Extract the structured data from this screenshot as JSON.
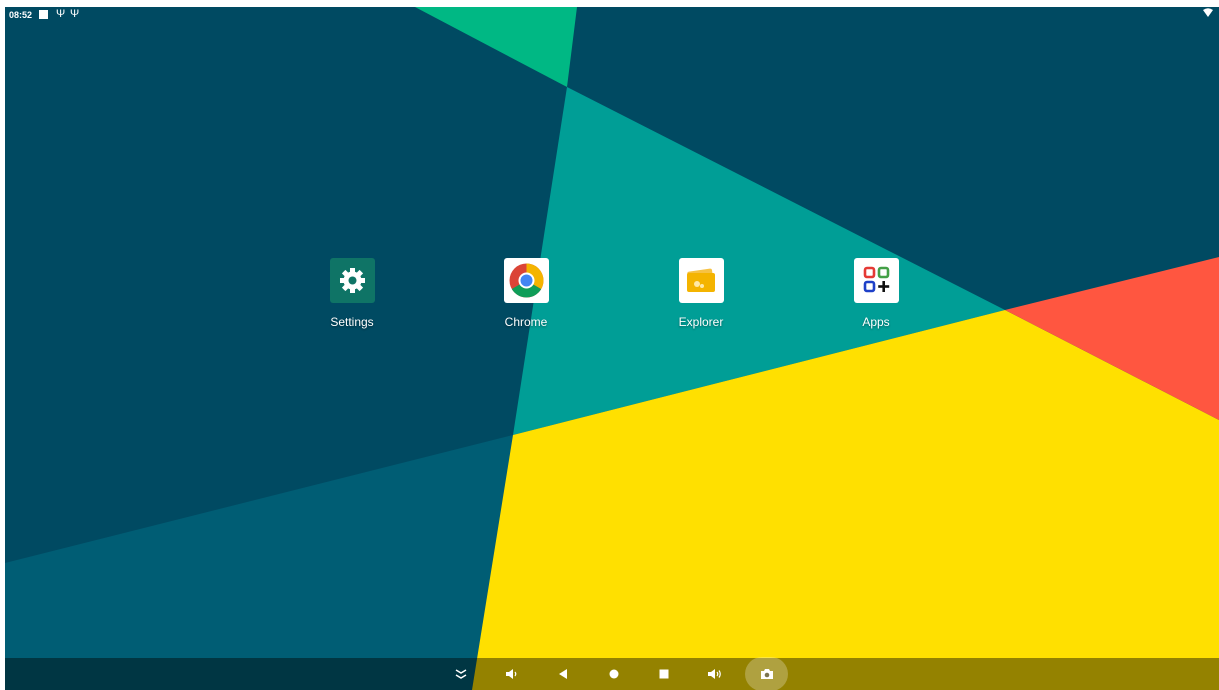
{
  "status_bar": {
    "time": "08:52",
    "icons": [
      "notification-square-icon",
      "usb-icon",
      "usb-icon",
      "wifi-icon"
    ]
  },
  "desktop": {
    "apps": [
      {
        "name": "settings",
        "label": "Settings",
        "icon": "gear-icon"
      },
      {
        "name": "chrome",
        "label": "Chrome",
        "icon": "chrome-icon"
      },
      {
        "name": "explorer",
        "label": "Explorer",
        "icon": "folder-icon"
      },
      {
        "name": "apps",
        "label": "Apps",
        "icon": "apps-grid-icon"
      }
    ]
  },
  "nav_bar": {
    "buttons": [
      "collapse-icon",
      "volume-down-icon",
      "back-icon",
      "home-icon",
      "recents-icon",
      "volume-up-icon",
      "screenshot-icon"
    ]
  },
  "colors": {
    "wallpaper_dark": "#004a62",
    "wallpaper_teal": "#009e96",
    "wallpaper_green": "#00b884",
    "wallpaper_yellow": "#ffe000",
    "wallpaper_red": "#ff5640",
    "wallpaper_blue": "#005d74",
    "settings_icon": "#0f7466"
  }
}
